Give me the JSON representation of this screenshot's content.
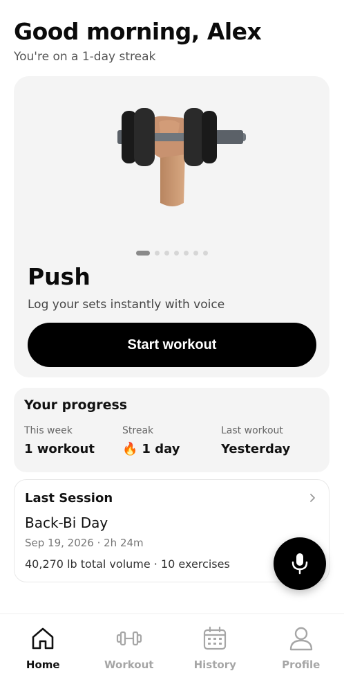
{
  "header": {
    "greeting": "Good morning, Alex",
    "streak_text": "You're on a 1-day streak"
  },
  "hero": {
    "image": "dumbbell-hand-icon",
    "carousel": {
      "total": 7,
      "active_index": 0
    },
    "title": "Push",
    "subtitle": "Log your sets instantly with voice",
    "start_label": "Start workout"
  },
  "progress": {
    "title": "Your progress",
    "stats": [
      {
        "label": "This week",
        "value": "1 workout"
      },
      {
        "label": "Streak",
        "value": "1 day",
        "icon": "🔥"
      },
      {
        "label": "Last workout",
        "value": "Yesterday"
      }
    ]
  },
  "last_session": {
    "heading": "Last Session",
    "name": "Back-Bi Day",
    "meta": "Sep 19, 2026 · 2h 24m",
    "volume": "40,270 lb total volume · 10 exercises"
  },
  "fab": {
    "icon": "microphone-icon"
  },
  "tabs": [
    {
      "label": "Home",
      "icon": "home-icon",
      "active": true
    },
    {
      "label": "Workout",
      "icon": "dumbbell-icon",
      "active": false
    },
    {
      "label": "History",
      "icon": "calendar-icon",
      "active": false
    },
    {
      "label": "Profile",
      "icon": "person-icon",
      "active": false
    }
  ],
  "colors": {
    "primary": "#000000",
    "card_bg": "#f4f4f4",
    "inactive": "#a6a6a6"
  }
}
